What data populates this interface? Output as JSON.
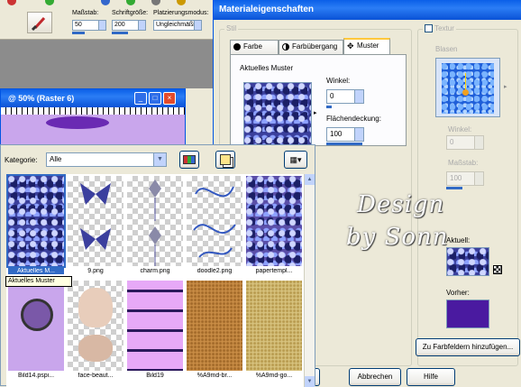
{
  "toolbar": {
    "groesse_label": "Maßstab:",
    "groesse_value": "50",
    "schrift_label": "Schriftgröße:",
    "schrift_value": "200",
    "platz_label": "Platzierungsmodus:",
    "platz_value": "Ungleichmäßig"
  },
  "image_window": {
    "title": "@ 50% (Raster 6)"
  },
  "dialog": {
    "title": "Materialeigenschaften",
    "stil_label": "Stil",
    "tabs": [
      {
        "label": "Farbe"
      },
      {
        "label": "Farbübergang"
      },
      {
        "label": "Muster"
      }
    ],
    "current_pattern_label": "Aktuelles Muster",
    "winkel_label": "Winkel:",
    "winkel_value": "0",
    "deckung_label": "Flächendeckung:",
    "deckung_value": "100",
    "textur": {
      "checkbox_label": "Textur",
      "name": "Blasen",
      "winkel_label": "Winkel:",
      "winkel_value": "0",
      "massstab_label": "Maßstab:",
      "massstab_value": "100"
    },
    "aktuell_label": "Aktuell:",
    "vorher_label": "Vorher:",
    "vorher_color": "#4a1aa0",
    "add_swatch_button": "Zu Farbfeldern hinzufügen...",
    "ok_button": "K",
    "cancel_button": "Abbrechen",
    "help_button": "Hilfe"
  },
  "picker": {
    "category_label": "Kategorie:",
    "category_value": "Alle",
    "tooltip": "Aktuelles Muster",
    "thumbnails": [
      {
        "label": "Aktuelles M..."
      },
      {
        "label": "9.png"
      },
      {
        "label": "charm.png"
      },
      {
        "label": "doodle2.png"
      },
      {
        "label": "papertempl..."
      },
      {
        "label": "Bild14.pspi..."
      },
      {
        "label": "face-beaut..."
      },
      {
        "label": "Bild19"
      },
      {
        "label": "%A9md-br..."
      },
      {
        "label": "%A9md-go..."
      }
    ]
  },
  "watermark": {
    "line1": "Design",
    "line2": "by Sonn"
  }
}
